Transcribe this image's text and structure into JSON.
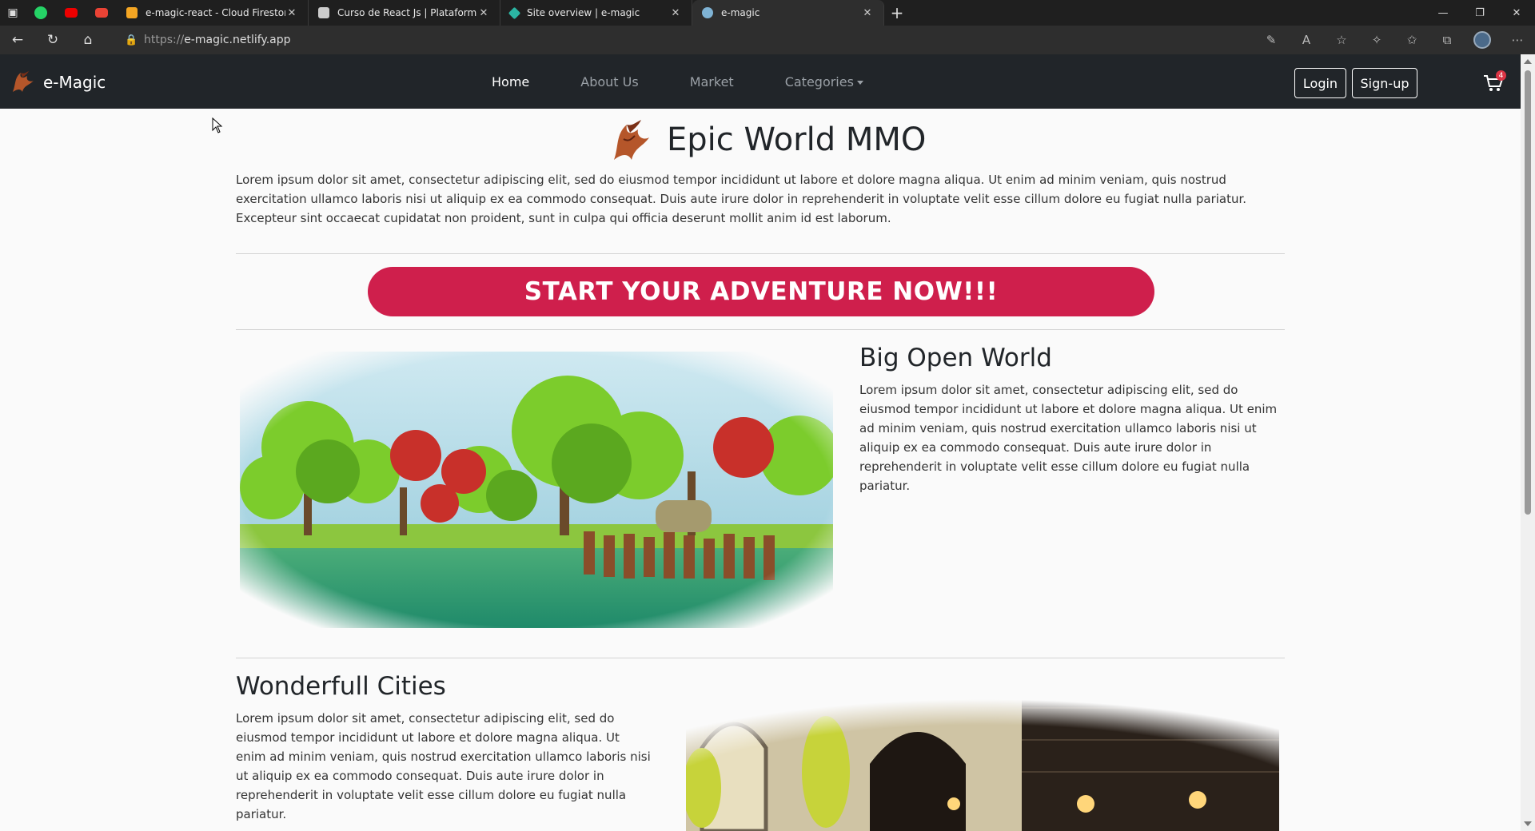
{
  "browser": {
    "tabs": [
      {
        "title": "e-magic-react - Cloud Firestore",
        "favicon": "firebase-flame-icon",
        "color": "#f5a623"
      },
      {
        "title": "Curso de React Js | Plataforma el",
        "favicon": "course-site-icon",
        "color": "#cccccc"
      },
      {
        "title": "Site overview | e-magic",
        "favicon": "netlify-diamond-icon",
        "color": "#2bb5a3"
      },
      {
        "title": "e-magic",
        "favicon": "globe-icon",
        "color": "#7fb3d5"
      }
    ],
    "url_protocol": "https://",
    "url_host": "e-magic.netlify.app"
  },
  "nav": {
    "brand": "e-Magic",
    "links": [
      "Home",
      "About Us",
      "Market",
      "Categories"
    ],
    "login": "Login",
    "signup": "Sign-up",
    "cart_count": "4"
  },
  "hero": {
    "title": "Epic World MMO",
    "text": "Lorem ipsum dolor sit amet, consectetur adipiscing elit, sed do eiusmod tempor incididunt ut labore et dolore magna aliqua. Ut enim ad minim veniam, quis nostrud exercitation ullamco laboris nisi ut aliquip ex ea commodo consequat. Duis aute irure dolor in reprehenderit in voluptate velit esse cillum dolore eu fugiat nulla pariatur. Excepteur sint occaecat cupidatat non proident, sunt in culpa qui officia deserunt mollit anim id est laborum.",
    "cta": "START YOUR ADVENTURE NOW!!!"
  },
  "features": [
    {
      "title": "Big Open World",
      "text": "Lorem ipsum dolor sit amet, consectetur adipiscing elit, sed do eiusmod tempor incididunt ut labore et dolore magna aliqua. Ut enim ad minim veniam, quis nostrud exercitation ullamco laboris nisi ut aliquip ex ea commodo consequat. Duis aute irure dolor in reprehenderit in voluptate velit esse cillum dolore eu fugiat nulla pariatur."
    },
    {
      "title": "Wonderfull Cities",
      "text": "Lorem ipsum dolor sit amet, consectetur adipiscing elit, sed do eiusmod tempor incididunt ut labore et dolore magna aliqua. Ut enim ad minim veniam, quis nostrud exercitation ullamco laboris nisi ut aliquip ex ea commodo consequat. Duis aute irure dolor in reprehenderit in voluptate velit esse cillum dolore eu fugiat nulla pariatur."
    }
  ],
  "colors": {
    "navbar": "#212529",
    "cta": "#cf1f4c"
  }
}
